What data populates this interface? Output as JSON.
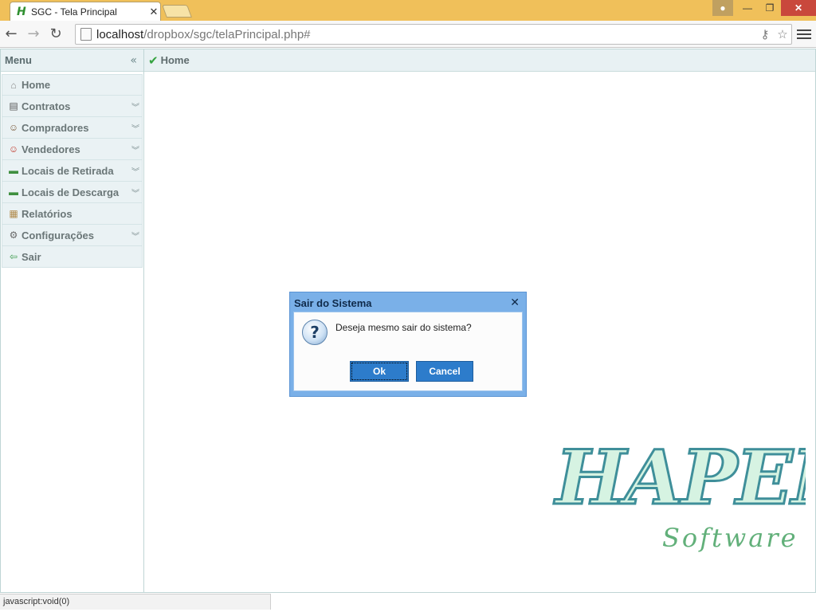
{
  "browser": {
    "tab_title": "SGC - Tela Principal",
    "tab_favicon": "H",
    "url_host": "localhost",
    "url_path": "/dropbox/sgc/telaPrincipal.php#",
    "status_text": "javascript:void(0)"
  },
  "west": {
    "title": "Menu",
    "items": [
      {
        "label": "Home",
        "icon": "home-icon",
        "expandable": false
      },
      {
        "label": "Contratos",
        "icon": "contract-icon",
        "expandable": true
      },
      {
        "label": "Compradores",
        "icon": "buyer-icon",
        "expandable": true
      },
      {
        "label": "Vendedores",
        "icon": "seller-icon",
        "expandable": true
      },
      {
        "label": "Locais de Retirada",
        "icon": "truck-icon",
        "expandable": true
      },
      {
        "label": "Locais de Descarga",
        "icon": "truck-icon",
        "expandable": true
      },
      {
        "label": "Relatórios",
        "icon": "report-icon",
        "expandable": false
      },
      {
        "label": "Configurações",
        "icon": "gear-icon",
        "expandable": true
      },
      {
        "label": "Sair",
        "icon": "exit-icon",
        "expandable": false
      }
    ]
  },
  "center": {
    "tab_label": "Home"
  },
  "logo": {
    "main": "HAPEN",
    "sub": "Software"
  },
  "dialog": {
    "title": "Sair do Sistema",
    "message": "Deseja mesmo sair do sistema?",
    "ok_label": "Ok",
    "cancel_label": "Cancel"
  },
  "colors": {
    "titlebar": "#f0c05a",
    "panel_header": "#e8f1f3",
    "dialog_frame": "#7ab0e8",
    "button": "#2d7ccb"
  }
}
